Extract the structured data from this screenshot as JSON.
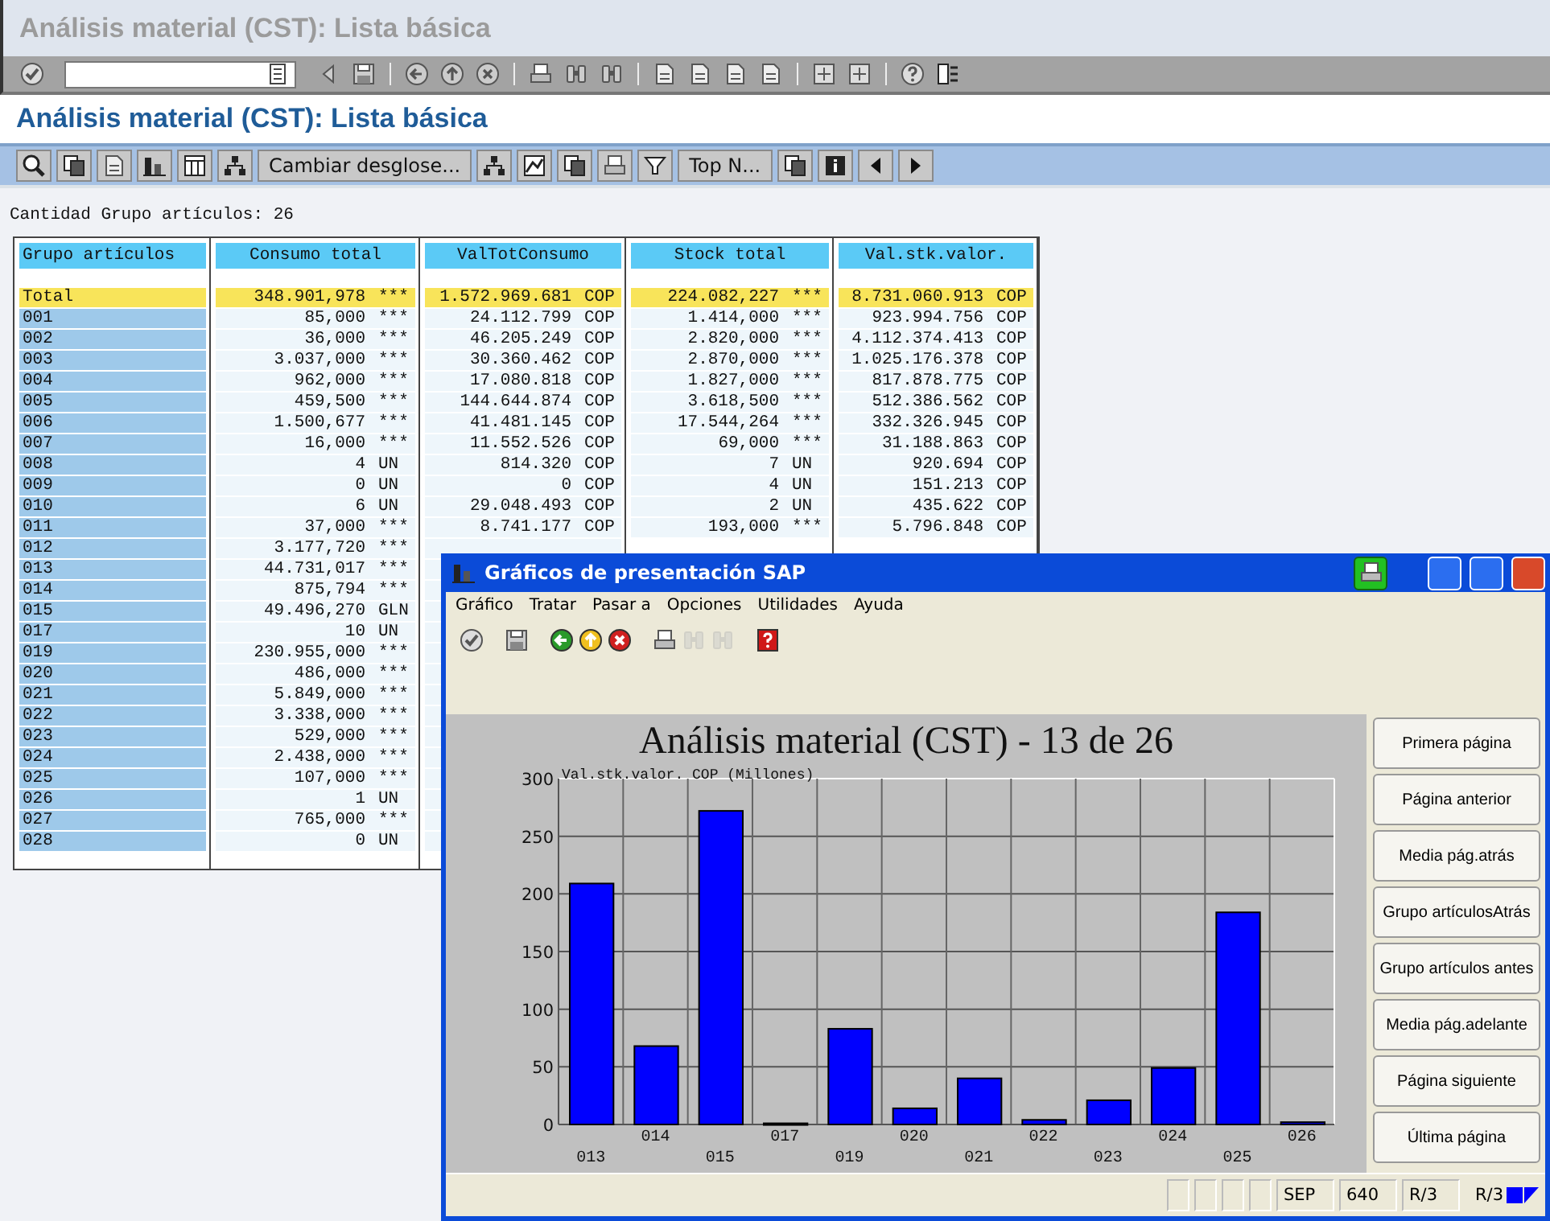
{
  "window": {
    "title": "Análisis material (CST): Lista básica"
  },
  "screen_title": "Análisis material (CST): Lista básica",
  "app_toolbar": {
    "buttons": [
      {
        "label": "Cambiar desglose..."
      },
      {
        "label": "Top N..."
      }
    ]
  },
  "summary": "Cantidad Grupo artículos: 26",
  "table": {
    "columns": [
      "Grupo artículos",
      "Consumo total",
      "ValTotConsumo",
      "Stock total",
      "Val.stk.valor."
    ],
    "rows": [
      {
        "kind": "total",
        "cells": [
          {
            "value": "Total"
          },
          {
            "value": "348.901,978",
            "unit": "***"
          },
          {
            "value": "1.572.969.681",
            "unit": "COP"
          },
          {
            "value": "224.082,227",
            "unit": "***"
          },
          {
            "value": "8.731.060.913",
            "unit": "COP"
          }
        ]
      },
      {
        "kind": "item",
        "cells": [
          {
            "value": "001"
          },
          {
            "value": "85,000",
            "unit": "***"
          },
          {
            "value": "24.112.799",
            "unit": "COP"
          },
          {
            "value": "1.414,000",
            "unit": "***"
          },
          {
            "value": "923.994.756",
            "unit": "COP"
          }
        ]
      },
      {
        "kind": "item",
        "cells": [
          {
            "value": "002"
          },
          {
            "value": "36,000",
            "unit": "***"
          },
          {
            "value": "46.205.249",
            "unit": "COP"
          },
          {
            "value": "2.820,000",
            "unit": "***"
          },
          {
            "value": "4.112.374.413",
            "unit": "COP"
          }
        ]
      },
      {
        "kind": "item",
        "cells": [
          {
            "value": "003"
          },
          {
            "value": "3.037,000",
            "unit": "***"
          },
          {
            "value": "30.360.462",
            "unit": "COP"
          },
          {
            "value": "2.870,000",
            "unit": "***"
          },
          {
            "value": "1.025.176.378",
            "unit": "COP"
          }
        ]
      },
      {
        "kind": "item",
        "cells": [
          {
            "value": "004"
          },
          {
            "value": "962,000",
            "unit": "***"
          },
          {
            "value": "17.080.818",
            "unit": "COP"
          },
          {
            "value": "1.827,000",
            "unit": "***"
          },
          {
            "value": "817.878.775",
            "unit": "COP"
          }
        ]
      },
      {
        "kind": "item",
        "cells": [
          {
            "value": "005"
          },
          {
            "value": "459,500",
            "unit": "***"
          },
          {
            "value": "144.644.874",
            "unit": "COP"
          },
          {
            "value": "3.618,500",
            "unit": "***"
          },
          {
            "value": "512.386.562",
            "unit": "COP"
          }
        ]
      },
      {
        "kind": "item",
        "cells": [
          {
            "value": "006"
          },
          {
            "value": "1.500,677",
            "unit": "***"
          },
          {
            "value": "41.481.145",
            "unit": "COP"
          },
          {
            "value": "17.544,264",
            "unit": "***"
          },
          {
            "value": "332.326.945",
            "unit": "COP"
          }
        ]
      },
      {
        "kind": "item",
        "cells": [
          {
            "value": "007"
          },
          {
            "value": "16,000",
            "unit": "***"
          },
          {
            "value": "11.552.526",
            "unit": "COP"
          },
          {
            "value": "69,000",
            "unit": "***"
          },
          {
            "value": "31.188.863",
            "unit": "COP"
          }
        ]
      },
      {
        "kind": "item",
        "cells": [
          {
            "value": "008"
          },
          {
            "value": "4",
            "unit": "UN"
          },
          {
            "value": "814.320",
            "unit": "COP"
          },
          {
            "value": "7",
            "unit": "UN"
          },
          {
            "value": "920.694",
            "unit": "COP"
          }
        ]
      },
      {
        "kind": "item",
        "cells": [
          {
            "value": "009"
          },
          {
            "value": "0",
            "unit": "UN"
          },
          {
            "value": "0",
            "unit": "COP"
          },
          {
            "value": "4",
            "unit": "UN"
          },
          {
            "value": "151.213",
            "unit": "COP"
          }
        ]
      },
      {
        "kind": "item",
        "cells": [
          {
            "value": "010"
          },
          {
            "value": "6",
            "unit": "UN"
          },
          {
            "value": "29.048.493",
            "unit": "COP"
          },
          {
            "value": "2",
            "unit": "UN"
          },
          {
            "value": "435.622",
            "unit": "COP"
          }
        ]
      },
      {
        "kind": "item",
        "cells": [
          {
            "value": "011"
          },
          {
            "value": "37,000",
            "unit": "***"
          },
          {
            "value": "8.741.177",
            "unit": "COP"
          },
          {
            "value": "193,000",
            "unit": "***"
          },
          {
            "value": "5.796.848",
            "unit": "COP"
          }
        ]
      },
      {
        "kind": "item",
        "cells": [
          {
            "value": "012"
          },
          {
            "value": "3.177,720",
            "unit": "***"
          }
        ]
      },
      {
        "kind": "item",
        "cells": [
          {
            "value": "013"
          },
          {
            "value": "44.731,017",
            "unit": "***"
          }
        ]
      },
      {
        "kind": "item",
        "cells": [
          {
            "value": "014"
          },
          {
            "value": "875,794",
            "unit": "***"
          }
        ]
      },
      {
        "kind": "item",
        "cells": [
          {
            "value": "015"
          },
          {
            "value": "49.496,270",
            "unit": "GLN"
          }
        ]
      },
      {
        "kind": "item",
        "cells": [
          {
            "value": "017"
          },
          {
            "value": "10",
            "unit": "UN"
          }
        ]
      },
      {
        "kind": "item",
        "cells": [
          {
            "value": "019"
          },
          {
            "value": "230.955,000",
            "unit": "***"
          }
        ]
      },
      {
        "kind": "item",
        "cells": [
          {
            "value": "020"
          },
          {
            "value": "486,000",
            "unit": "***"
          }
        ]
      },
      {
        "kind": "item",
        "cells": [
          {
            "value": "021"
          },
          {
            "value": "5.849,000",
            "unit": "***"
          }
        ]
      },
      {
        "kind": "item",
        "cells": [
          {
            "value": "022"
          },
          {
            "value": "3.338,000",
            "unit": "***"
          }
        ]
      },
      {
        "kind": "item",
        "cells": [
          {
            "value": "023"
          },
          {
            "value": "529,000",
            "unit": "***"
          }
        ]
      },
      {
        "kind": "item",
        "cells": [
          {
            "value": "024"
          },
          {
            "value": "2.438,000",
            "unit": "***"
          }
        ]
      },
      {
        "kind": "item",
        "cells": [
          {
            "value": "025"
          },
          {
            "value": "107,000",
            "unit": "***"
          }
        ]
      },
      {
        "kind": "item",
        "cells": [
          {
            "value": "026"
          },
          {
            "value": "1",
            "unit": "UN"
          }
        ]
      },
      {
        "kind": "item",
        "cells": [
          {
            "value": "027"
          },
          {
            "value": "765,000",
            "unit": "***"
          }
        ]
      },
      {
        "kind": "item",
        "cells": [
          {
            "value": "028"
          },
          {
            "value": "0",
            "unit": "UN"
          }
        ]
      }
    ]
  },
  "popup": {
    "title": "Gráficos de presentación SAP",
    "menu": [
      "Gráfico",
      "Tratar",
      "Pasar a",
      "Opciones",
      "Utilidades",
      "Ayuda"
    ],
    "toolbar": [
      {
        "disabled": false
      },
      {
        "disabled": false
      },
      {
        "disabled": false
      },
      {
        "disabled": false
      },
      {
        "disabled": false
      },
      {
        "disabled": false
      },
      {
        "disabled": true
      },
      {
        "disabled": true
      },
      {
        "disabled": false
      }
    ],
    "chart_data": {
      "type": "bar",
      "title": "Análisis material (CST)  -  13 de 26",
      "ylabel": "Val.stk.valor. COP (Millones)",
      "categories": [
        "013",
        "014",
        "015",
        "017",
        "019",
        "020",
        "021",
        "022",
        "023",
        "024",
        "025",
        "026"
      ],
      "series": [
        {
          "color": "#0000ff",
          "values": [
            209,
            68,
            272,
            1,
            83,
            14,
            40,
            4,
            21,
            49,
            184,
            2
          ]
        }
      ],
      "grid": true,
      "ylim": [
        0,
        300
      ],
      "yticks": [
        0,
        50,
        100,
        150,
        200,
        250,
        300
      ]
    },
    "nav_buttons": [
      "Primera página",
      "Página anterior",
      "Media pág.atrás",
      "Grupo artículosAtrás",
      "Grupo artículos antes",
      "Media pág.adelante",
      "Página siguiente",
      "Última página"
    ],
    "status_fields": [
      "SEP",
      "640",
      "R/3"
    ],
    "system": "R/3"
  }
}
